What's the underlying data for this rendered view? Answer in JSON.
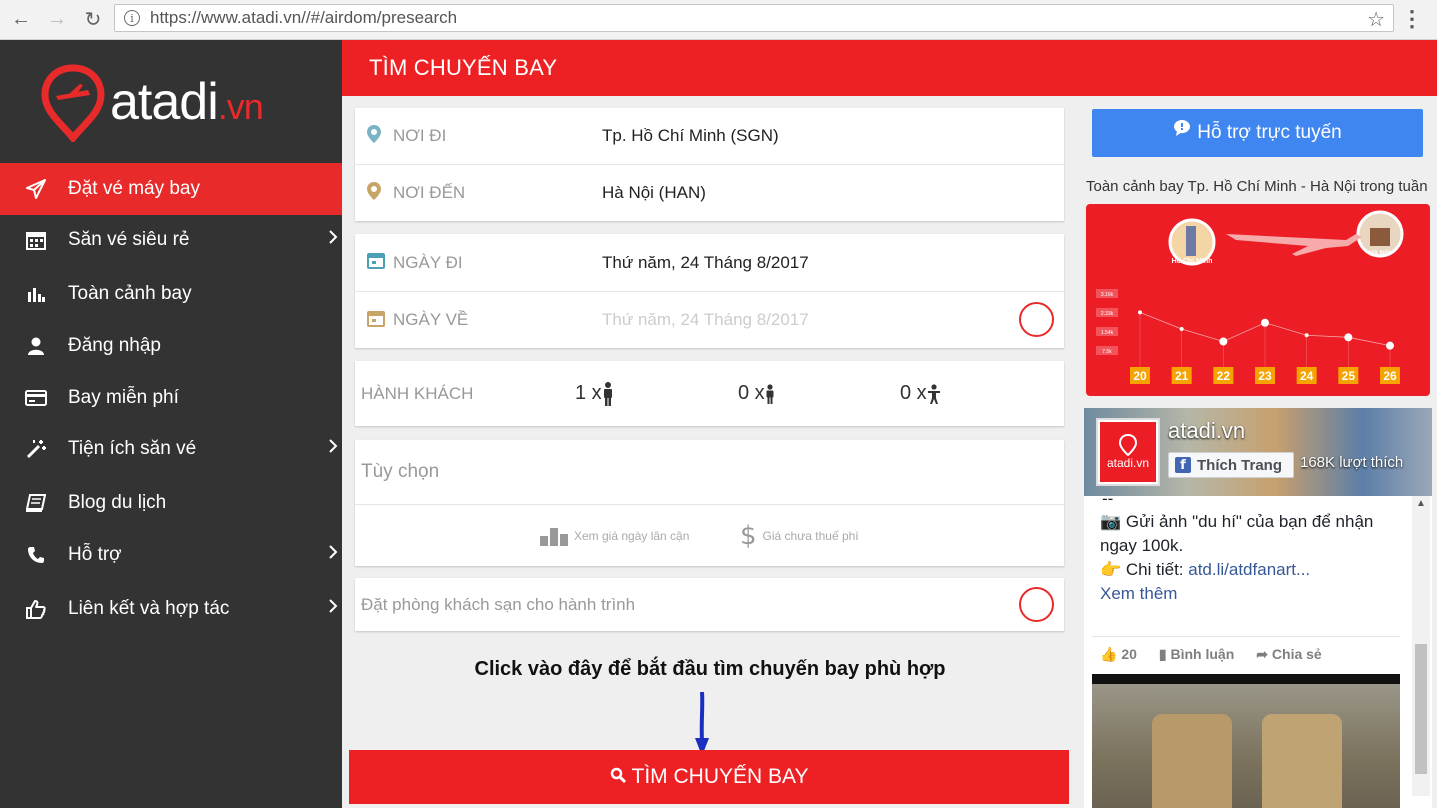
{
  "browser": {
    "url": "https://www.atadi.vn//#/airdom/presearch"
  },
  "sidebar": {
    "logo": {
      "main": "atadi",
      "suffix": ".vn"
    },
    "items": [
      {
        "label": "Đặt vé máy bay",
        "icon": "paper-plane-icon",
        "active": true,
        "submenu": false
      },
      {
        "label": "Săn vé siêu rẻ",
        "icon": "calendar-icon",
        "active": false,
        "submenu": true
      },
      {
        "label": "Toàn cảnh bay",
        "icon": "bar-chart-icon",
        "active": false,
        "submenu": false
      },
      {
        "label": "Đăng nhập",
        "icon": "user-icon",
        "active": false,
        "submenu": false
      },
      {
        "label": "Bay miễn phí",
        "icon": "credit-card-icon",
        "active": false,
        "submenu": false
      },
      {
        "label": "Tiện ích săn vé",
        "icon": "magic-wand-icon",
        "active": false,
        "submenu": true
      },
      {
        "label": "Blog du lịch",
        "icon": "book-icon",
        "active": false,
        "submenu": false
      },
      {
        "label": "Hỗ trợ",
        "icon": "phone-icon",
        "active": false,
        "submenu": true
      },
      {
        "label": "Liên kết và hợp tác",
        "icon": "thumbs-up-icon",
        "active": false,
        "submenu": true
      }
    ]
  },
  "header": {
    "title": "TÌM CHUYẾN BAY"
  },
  "form": {
    "from_label": "NƠI ĐI",
    "from_value": "Tp. Hồ Chí Minh (SGN)",
    "to_label": "NƠI ĐẾN",
    "to_value": "Hà Nội (HAN)",
    "depart_label": "NGÀY ĐI",
    "depart_value": "Thứ năm, 24 Tháng 8/2017",
    "return_label": "NGÀY VỀ",
    "return_value": "Thứ năm, 24 Tháng 8/2017",
    "passengers_label": "HÀNH KHÁCH",
    "adults": "1 x",
    "children": "0 x",
    "infants": "0 x",
    "options_label": "Tùy chọn",
    "nearby_label": "Xem giá ngày lân cận",
    "notax_label": "Giá chưa thuế phí",
    "hotel_label": "Đặt phòng khách sạn cho hành trình",
    "instruction": "Click vào đây để bắt đầu tìm chuyến bay phù hợp",
    "search_label": "TÌM CHUYẾN BAY"
  },
  "right": {
    "support_label": "Hỗ trợ trực tuyến",
    "panorama_title": "Toàn cảnh bay Tp. Hồ Chí Minh - Hà Nội trong tuần",
    "origin_city": "Hồ Chí Minh",
    "dest_city": "Hà Nội"
  },
  "chart_data": {
    "type": "line",
    "title": "",
    "categories": [
      "20",
      "21",
      "22",
      "23",
      "24",
      "25",
      "26"
    ],
    "y_tick_labels": [
      "3.16k",
      "2.33k",
      "1.54k",
      "7.5k"
    ],
    "series": [
      {
        "values": [
          3.0,
          2.6,
          2.3,
          2.75,
          2.45,
          2.4,
          2.2
        ]
      }
    ]
  },
  "facebook": {
    "page_name": "atadi.vn",
    "logo_text": "atadi.vn",
    "like_label": "Thích Trang",
    "likes": "168K lượt thích",
    "post_dash": "--",
    "post_line1": "📷 Gửi ảnh \"du hí\" của bạn để nhận ngay 100k.",
    "post_line2_prefix": "👉 Chi tiết: ",
    "post_link": "atd.li/atdfanart...",
    "see_more": "Xem thêm",
    "like_count": "20",
    "comment_label": "Bình luận",
    "share_label": "Chia sẻ"
  }
}
